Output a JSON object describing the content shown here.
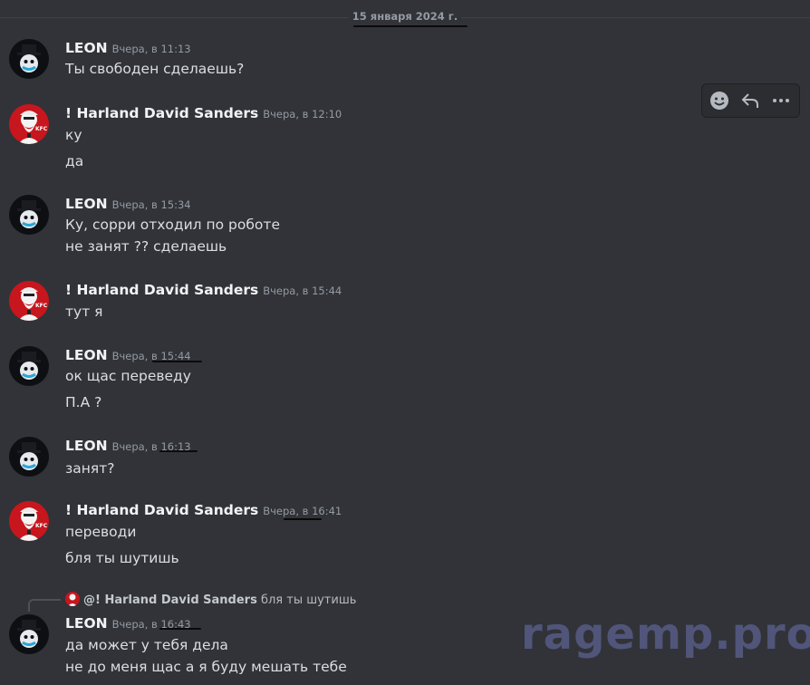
{
  "date_divider": "15 января 2024 г.",
  "toolbar": {
    "icons": [
      "emoji-icon",
      "reply-icon",
      "more-icon"
    ]
  },
  "messages": [
    {
      "author": "LEON",
      "avatar": "leon",
      "timestamp": "Вчера, в 11:13",
      "lines": [
        "Ты свободен сделаешь?"
      ]
    },
    {
      "author": "! Harland David Sanders",
      "avatar": "kfc",
      "timestamp": "Вчера, в 12:10",
      "lines": [
        "ку",
        "да"
      ]
    },
    {
      "author": "LEON",
      "avatar": "leon",
      "timestamp": "Вчера, в 15:34",
      "lines": [
        "Ку, сорри отходил по роботе",
        "не занят ?? сделаешь"
      ]
    },
    {
      "author": "! Harland David Sanders",
      "avatar": "kfc",
      "timestamp": "Вчера, в 15:44",
      "lines": [
        "тут я"
      ]
    },
    {
      "author": "LEON",
      "avatar": "leon",
      "timestamp": "Вчера, в 15:44",
      "lines": [
        "ок щас переведу",
        "П.А ?"
      ]
    },
    {
      "author": "LEON",
      "avatar": "leon",
      "timestamp": "Вчера, в 16:13",
      "lines": [
        "занят?"
      ]
    },
    {
      "author": "! Harland David Sanders",
      "avatar": "kfc",
      "timestamp": "Вчера, в 16:41",
      "lines": [
        "переводи",
        "бля ты шутишь"
      ]
    },
    {
      "author": "LEON",
      "avatar": "leon",
      "timestamp": "Вчера, в 16:43",
      "lines": [
        "да может у тебя дела",
        "не до меня щас а я буду мешать тебе"
      ]
    }
  ],
  "reply": {
    "mention": "@! Harland David Sanders",
    "text": "бля ты шутишь"
  },
  "watermark": "ragemp.pro",
  "colors": {
    "background": "#313338",
    "text": "#dbdee1",
    "muted": "#949ba4",
    "kfc_red": "#c7161d"
  }
}
